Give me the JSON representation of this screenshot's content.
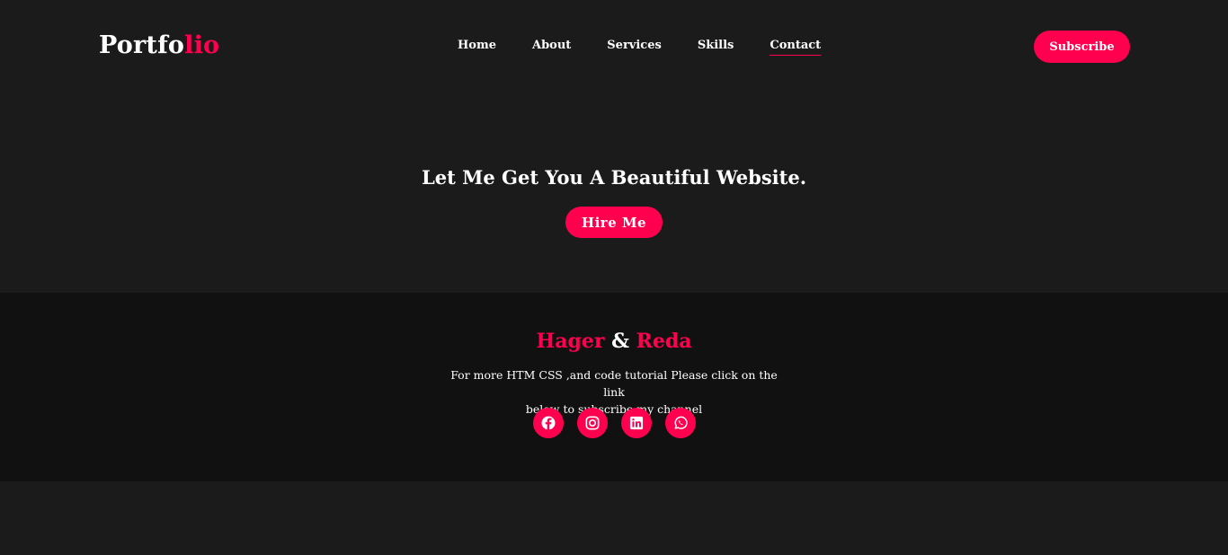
{
  "header": {
    "logo_main": "Portfo",
    "logo_accent": "lio",
    "nav": [
      {
        "label": "Home"
      },
      {
        "label": "About"
      },
      {
        "label": "Services"
      },
      {
        "label": "Skills"
      },
      {
        "label": "Contact",
        "active": true
      }
    ],
    "subscribe_label": "Subscribe"
  },
  "hero": {
    "title": "Let Me Get You A Beautiful Website.",
    "button_label": "Hire Me"
  },
  "footer": {
    "name_first": "Hager",
    "name_amp": " & ",
    "name_second": "Reda",
    "text_line1": "For more HTM CSS ,and code tutorial Please click on the link",
    "text_line2": "below to subscribe my channel",
    "socials": [
      {
        "icon": "facebook-icon"
      },
      {
        "icon": "instagram-icon"
      },
      {
        "icon": "linkedin-icon"
      },
      {
        "icon": "whatsapp-icon"
      }
    ]
  },
  "colors": {
    "accent": "#ff004f",
    "background": "#1b1b1b",
    "footer_background": "#111111",
    "text": "#ffffff"
  }
}
